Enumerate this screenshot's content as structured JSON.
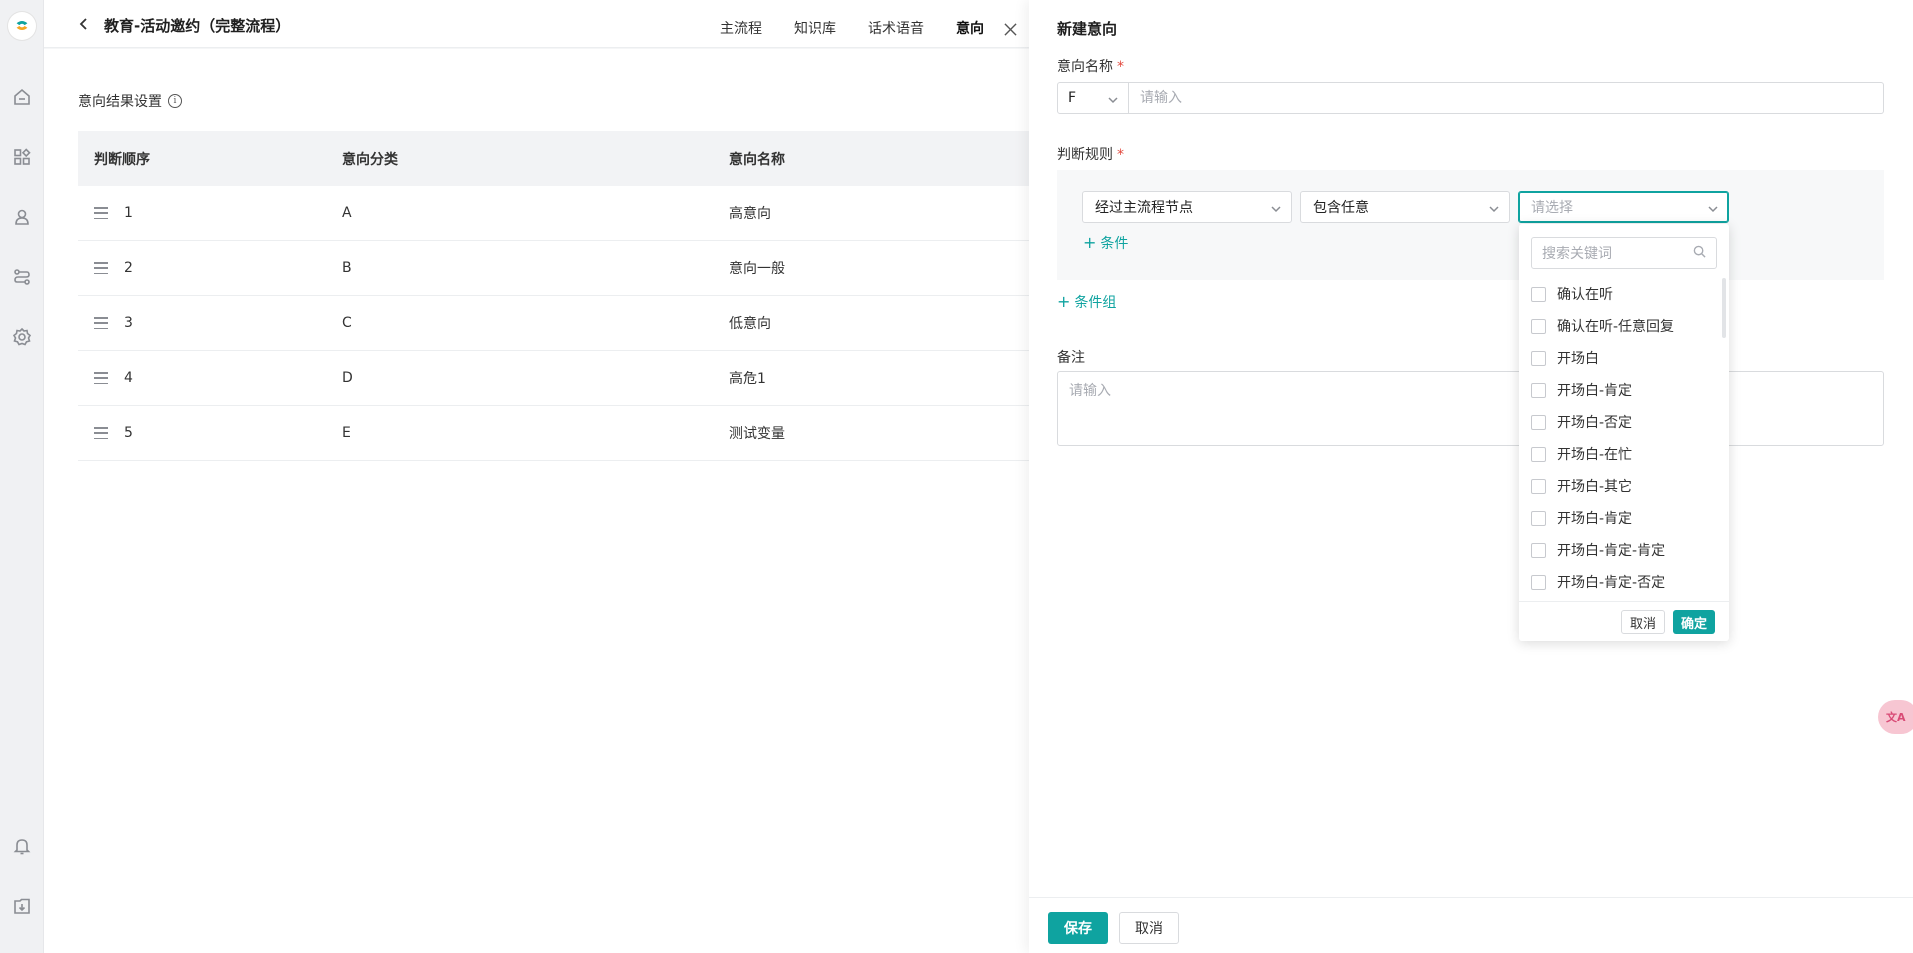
{
  "page": {
    "title": "教育-活动邀约（完整流程）",
    "tabs": [
      {
        "label": "主流程"
      },
      {
        "label": "知识库"
      },
      {
        "label": "话术语音"
      },
      {
        "label": "意向",
        "active": true
      }
    ]
  },
  "intent_table": {
    "section_title": "意向结果设置",
    "columns": [
      "判断顺序",
      "意向分类",
      "意向名称"
    ],
    "rows": [
      {
        "order": "1",
        "category": "A",
        "name": "高意向"
      },
      {
        "order": "2",
        "category": "B",
        "name": "意向一般"
      },
      {
        "order": "3",
        "category": "C",
        "name": "低意向"
      },
      {
        "order": "4",
        "category": "D",
        "name": "高危1"
      },
      {
        "order": "5",
        "category": "E",
        "name": "测试变量"
      }
    ]
  },
  "drawer": {
    "title": "新建意向",
    "name_label": "意向名称",
    "required_mark": "*",
    "prefix_value": "F",
    "name_placeholder": "请输入",
    "rule_label": "判断规则",
    "rule_select_1": "经过主流程节点",
    "rule_select_2": "包含任意",
    "rule_select_3_placeholder": "请选择",
    "add_condition": "条件",
    "add_condition_group": "条件组",
    "remark_label": "备注",
    "remark_placeholder": "请输入",
    "save_label": "保存",
    "cancel_label": "取消"
  },
  "dropdown": {
    "search_placeholder": "搜索关键词",
    "options": [
      "确认在听",
      "确认在听-任意回复",
      "开场白",
      "开场白-肯定",
      "开场白-否定",
      "开场白-在忙",
      "开场白-其它",
      "开场白-肯定",
      "开场白-肯定-肯定",
      "开场白-肯定-否定"
    ],
    "cancel_label": "取消",
    "confirm_label": "确定"
  },
  "colors": {
    "accent": "#0fa3a0",
    "required": "#e2483d"
  }
}
